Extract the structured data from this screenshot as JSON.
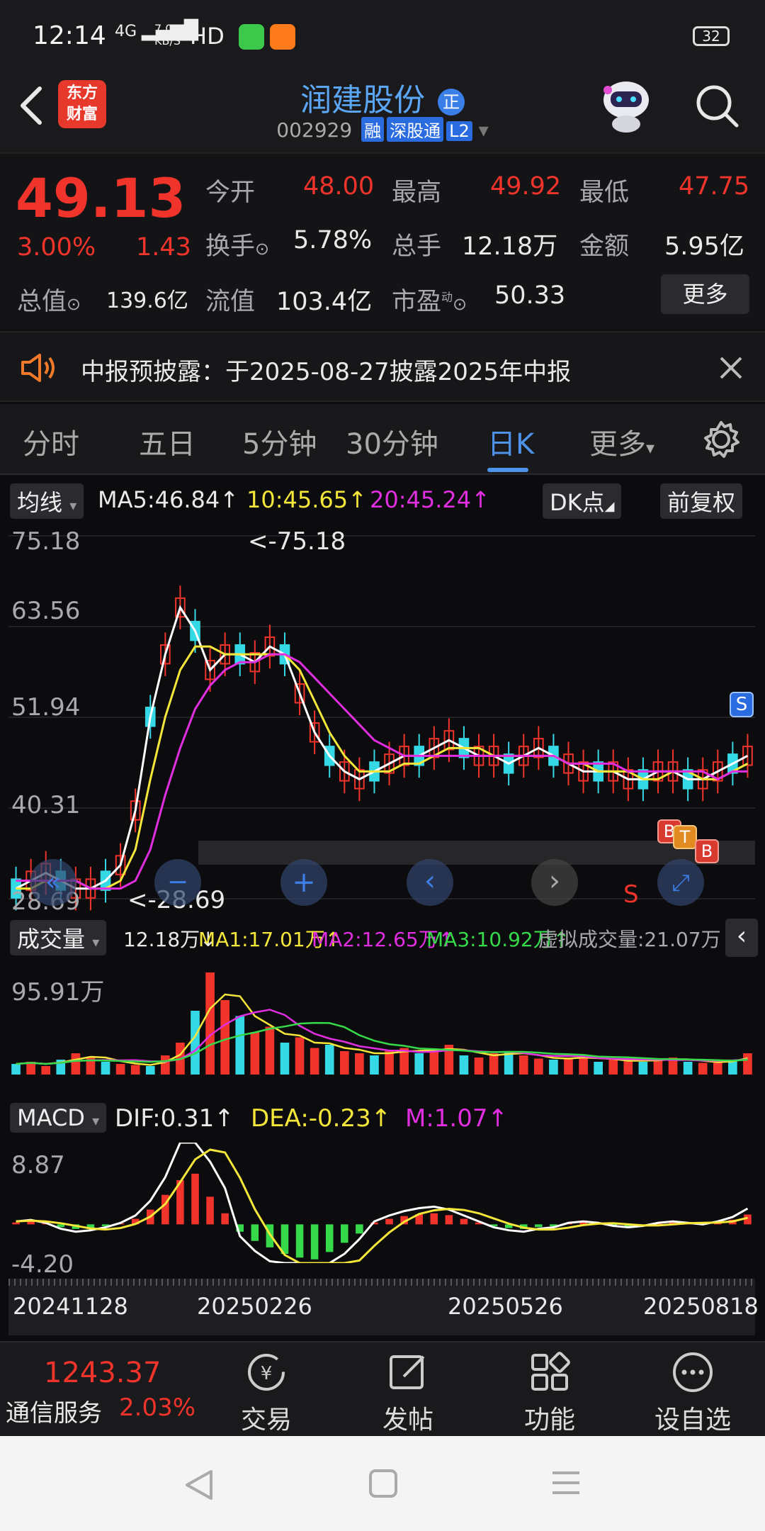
{
  "status_bar": {
    "time": "12:14",
    "network": "4G",
    "speed": "7.00",
    "speed_unit": "KB/S",
    "hd": "HD",
    "battery": "32"
  },
  "header": {
    "back_icon": "back-arrow-icon",
    "logo_text_1": "东方",
    "logo_text_2": "财富",
    "stock_name": "润建股份",
    "badge": "正",
    "code": "002929",
    "tag_margin": "融",
    "tag_connect": "深股通",
    "tag_l2": "L2",
    "search_icon": "search-icon"
  },
  "quote": {
    "price": "49.13",
    "change_pct": "3.00%",
    "change": "1.43",
    "open_label": "今开",
    "open": "48.00",
    "high_label": "最高",
    "high": "49.92",
    "low_label": "最低",
    "low": "47.75",
    "turnover_label": "换手",
    "turnover": "5.78%",
    "volume_label": "总手",
    "volume": "12.18万",
    "amount_label": "金额",
    "amount": "5.95亿",
    "mktcap_label": "总值",
    "mktcap": "139.6亿",
    "float_label": "流值",
    "float": "103.4亿",
    "pe_label": "市盈",
    "pe_sup": "动",
    "pe": "50.33",
    "more": "更多"
  },
  "notice": {
    "text": "中报预披露：于2025-08-27披露2025年中报"
  },
  "tabs": [
    "分时",
    "五日",
    "5分钟",
    "30分钟",
    "日K",
    "更多"
  ],
  "active_tab": "日K",
  "chart_header": {
    "ma_select": "均线",
    "ma5": "MA5:46.84",
    "ma10": "10:45.65",
    "ma20": "20:45.24",
    "dk": "DK点",
    "adjust": "前复权"
  },
  "chart_data": [
    {
      "type": "line",
      "title": "",
      "y_ticks": [
        "75.18",
        "63.56",
        "51.94",
        "40.31",
        "28.69"
      ],
      "max_label": "<-75.18",
      "min_label": "<-28.69",
      "markers": [
        "S",
        "B",
        "T",
        "B",
        "S"
      ],
      "series": [
        {
          "name": "MA5",
          "color": "#ffffff",
          "values": [
            30,
            31,
            32,
            31,
            30,
            30,
            31,
            33,
            40,
            52,
            60,
            66,
            63,
            58,
            60,
            60,
            59,
            61,
            60,
            55,
            50,
            47,
            45,
            44,
            45,
            46,
            47,
            47,
            48,
            49,
            48,
            47,
            47,
            46,
            47,
            48,
            47,
            46,
            45,
            45,
            45,
            44,
            44,
            45,
            45,
            44,
            44,
            45,
            46,
            47
          ]
        },
        {
          "name": "MA10",
          "color": "#f5e63a",
          "values": [
            30,
            30,
            31,
            31,
            31,
            30,
            30,
            31,
            35,
            44,
            52,
            58,
            61,
            61,
            60,
            60,
            60,
            60,
            60,
            58,
            54,
            50,
            47,
            45,
            45,
            45,
            46,
            46,
            47,
            48,
            48,
            48,
            47,
            47,
            47,
            47,
            47,
            46,
            46,
            45,
            45,
            45,
            44,
            44,
            45,
            45,
            44,
            44,
            45,
            46
          ]
        },
        {
          "name": "MA20",
          "color": "#e02ee0",
          "values": [
            31,
            31,
            31,
            31,
            31,
            30,
            30,
            30,
            31,
            35,
            42,
            48,
            53,
            56,
            58,
            59,
            59,
            60,
            60,
            59,
            57,
            55,
            53,
            51,
            49,
            48,
            47,
            47,
            47,
            47,
            47,
            47,
            47,
            47,
            47,
            47,
            47,
            46,
            46,
            46,
            46,
            45,
            45,
            45,
            45,
            45,
            45,
            44,
            45,
            45
          ]
        }
      ]
    },
    {
      "type": "bar",
      "title": "成交量",
      "volume": "12.18万",
      "ma1": "MA1:17.01万",
      "ma2": "MA2:12.65万",
      "ma3": "MA3:10.92万",
      "virtual": "虚拟成交量:21.07万",
      "y_max_label": "95.91万",
      "values": [
        10,
        12,
        8,
        14,
        20,
        16,
        12,
        10,
        9,
        8,
        18,
        30,
        60,
        96,
        70,
        55,
        40,
        45,
        30,
        35,
        25,
        28,
        22,
        20,
        18,
        22,
        25,
        20,
        24,
        28,
        18,
        16,
        20,
        22,
        18,
        15,
        14,
        16,
        18,
        12,
        14,
        13,
        12,
        15,
        16,
        12,
        11,
        12,
        14,
        20
      ]
    },
    {
      "type": "bar",
      "title": "MACD",
      "dif": "DIF:0.31",
      "dea": "DEA:-0.23",
      "m": "M:1.07",
      "y_ticks": [
        "8.87",
        "-4.20"
      ],
      "values": [
        0.2,
        0.3,
        0.1,
        -0.3,
        -0.5,
        -0.4,
        -0.2,
        0.1,
        0.6,
        1.6,
        3.2,
        4.8,
        5.5,
        3.0,
        1.2,
        -0.8,
        -1.8,
        -2.5,
        -3.2,
        -3.6,
        -3.8,
        -3.0,
        -2.0,
        -1.0,
        0.2,
        0.6,
        0.9,
        1.1,
        1.2,
        1.0,
        0.6,
        0.2,
        -0.2,
        -0.4,
        -0.5,
        -0.3,
        -0.2,
        0.1,
        0.2,
        0.1,
        -0.1,
        -0.2,
        -0.1,
        0.1,
        0.2,
        0.1,
        0.0,
        0.2,
        0.5,
        1.07
      ]
    }
  ],
  "x_ticks": [
    "20241128",
    "20250226",
    "20250526",
    "20250818"
  ],
  "bottom": {
    "index_value": "1243.37",
    "sector": "通信服务",
    "sector_pct": "2.03%",
    "trade": "交易",
    "post": "发帖",
    "func": "功能",
    "watch": "设自选"
  },
  "colors": {
    "up": "#f0342b",
    "down": "#35d9e6",
    "accent": "#4e93ea"
  }
}
